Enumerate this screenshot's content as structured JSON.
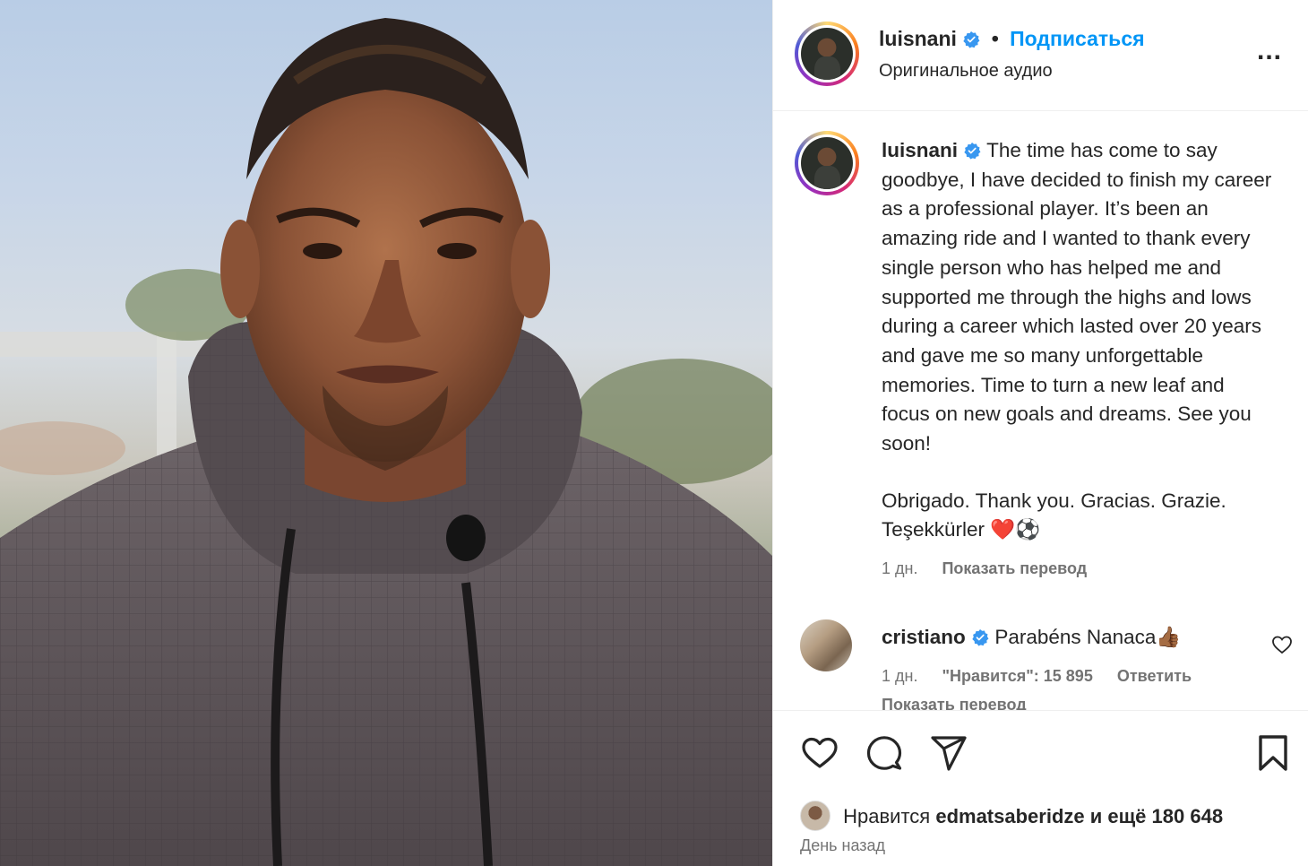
{
  "header": {
    "username": "luisnani",
    "separator": "•",
    "follow_label": "Подписаться",
    "audio_label": "Оригинальное аудио",
    "more_label": "..."
  },
  "caption": {
    "username": "luisnani",
    "paragraph1": "The time has come to say goodbye, I have decided to finish my career as a professional player. It’s been an amazing ride and I wanted to thank every single person who has helped me and supported me through the highs and lows during a career which lasted over 20 years and gave me so many unforgettable memories. Time to turn a new leaf and focus on new goals and dreams. See you soon!",
    "paragraph2": "Obrigado. Thank you. Gracias. Grazie. Teşekkürler ❤️⚽",
    "age": "1 дн.",
    "translate_label": "Показать перевод"
  },
  "comment": {
    "username": "cristiano",
    "text": "Parabéns Nanaca👍🏾",
    "age": "1 дн.",
    "likes_label": "\"Нравится\": 15 895",
    "reply_label": "Ответить",
    "translate_label": "Показать перевод"
  },
  "likes": {
    "prefix": "Нравится",
    "user": "edmatsaberidze",
    "suffix": "и ещё 180 648"
  },
  "posted": "День назад",
  "colors": {
    "accent": "#0095f6",
    "verified": "#3897f0",
    "text": "#262626",
    "secondary": "#737373"
  }
}
